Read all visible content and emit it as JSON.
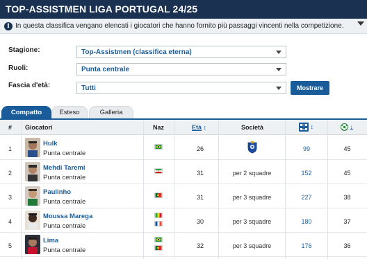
{
  "header": {
    "title": "Top-Assistmen Liga Portugal 24/25",
    "info_text": "In questa classifica vengano elencati i giocatori che hanno fornito più passaggi vincenti nella competizione.",
    "info_icon": "i"
  },
  "filters": {
    "season_label": "Stagione:",
    "season_value": "Top-Assistmen (classifica eterna)",
    "role_label": "Ruoli:",
    "role_value": "Punta centrale",
    "age_label": "Fascia d'età:",
    "age_value": "Tutti",
    "submit_label": "Mostrare"
  },
  "tabs": [
    {
      "label": "Compatto",
      "active": true
    },
    {
      "label": "Esteso",
      "active": false
    },
    {
      "label": "Galleria",
      "active": false
    }
  ],
  "columns": {
    "rank": "#",
    "players": "Giocatori",
    "nat": "Naz",
    "age": "Età",
    "age_sort": "↕",
    "club": "Società",
    "passes_sort": "↕",
    "goals_sort": "↓"
  },
  "rows": [
    {
      "rank": "1",
      "name": "Hulk",
      "role": "Punta centrale",
      "flags": [
        "brazil"
      ],
      "age": "26",
      "club": "",
      "club_icon": "porto-crest",
      "passes": "99",
      "goals": "45"
    },
    {
      "rank": "2",
      "name": "Mehdi Taremi",
      "role": "Punta centrale",
      "flags": [
        "iran"
      ],
      "age": "31",
      "club": "per 2 squadre",
      "passes": "152",
      "goals": "45"
    },
    {
      "rank": "3",
      "name": "Paulinho",
      "role": "Punta centrale",
      "flags": [
        "portugal"
      ],
      "age": "31",
      "club": "per 3 squadre",
      "passes": "227",
      "goals": "38"
    },
    {
      "rank": "4",
      "name": "Moussa Marega",
      "role": "Punta centrale",
      "flags": [
        "mali",
        "france"
      ],
      "age": "30",
      "club": "per 3 squadre",
      "passes": "180",
      "goals": "37"
    },
    {
      "rank": "5",
      "name": "Lima",
      "role": "Punta centrale",
      "flags": [
        "brazil",
        "portugal"
      ],
      "age": "32",
      "club": "per 3 squadre",
      "passes": "176",
      "goals": "36"
    }
  ],
  "colors": {
    "navy": "#1a3151",
    "accent": "#1a5c99"
  }
}
